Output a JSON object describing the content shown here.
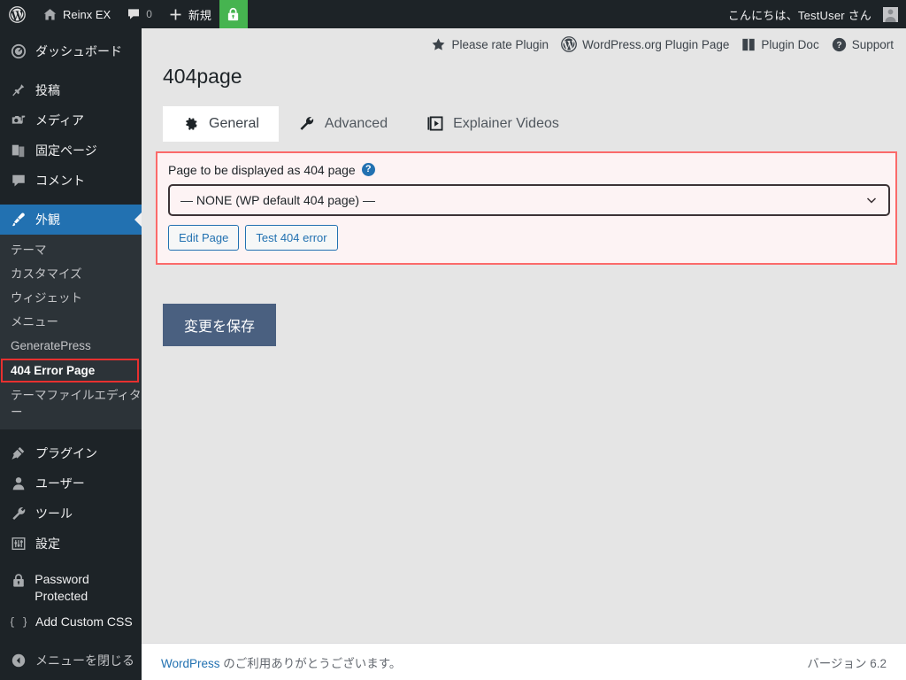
{
  "adminbar": {
    "wp_logo_icon": "wordpress-logo-icon",
    "site_icon": "home-icon",
    "site_name": "Reinx EX",
    "comments_icon": "comment-bubble-icon",
    "comments_count": "0",
    "new_icon": "plus-icon",
    "new_label": "新規",
    "lock_icon": "lock-icon",
    "greeting": "こんにちは、TestUser さん",
    "avatar_icon": "user-avatar-icon"
  },
  "sidebar": {
    "items": [
      {
        "label": "ダッシュボード",
        "icon": "dashboard-gauge-icon",
        "key": "dashboard"
      },
      {
        "label": "投稿",
        "icon": "pin-icon",
        "key": "posts"
      },
      {
        "label": "メディア",
        "icon": "media-camera-music-icon",
        "key": "media"
      },
      {
        "label": "固定ページ",
        "icon": "pages-icon",
        "key": "pages"
      },
      {
        "label": "コメント",
        "icon": "comment-bubble-icon",
        "key": "comments"
      },
      {
        "label": "外観",
        "icon": "paintbrush-icon",
        "key": "appearance",
        "current": true
      },
      {
        "label": "プラグイン",
        "icon": "plug-icon",
        "key": "plugins"
      },
      {
        "label": "ユーザー",
        "icon": "user-icon",
        "key": "users"
      },
      {
        "label": "ツール",
        "icon": "wrench-icon",
        "key": "tools"
      },
      {
        "label": "設定",
        "icon": "sliders-icon",
        "key": "settings"
      },
      {
        "label": "Password Protected",
        "icon": "lock-icon",
        "key": "password-protected"
      },
      {
        "label": "Add Custom CSS",
        "icon": "curly-braces-icon",
        "key": "add-custom-css"
      }
    ],
    "appearance_submenu": [
      {
        "label": "テーマ",
        "key": "themes"
      },
      {
        "label": "カスタマイズ",
        "key": "customize"
      },
      {
        "label": "ウィジェット",
        "key": "widgets"
      },
      {
        "label": "メニュー",
        "key": "menus"
      },
      {
        "label": "GeneratePress",
        "key": "generatepress"
      },
      {
        "label": "404 Error Page",
        "key": "404-error-page",
        "current": true,
        "highlighted": true
      },
      {
        "label": "テーマファイルエディター",
        "key": "theme-file-editor"
      }
    ],
    "collapse_label": "メニューを閉じる",
    "collapse_icon": "collapse-arrow-icon"
  },
  "plugin_links": [
    {
      "label": "Please rate Plugin",
      "icon": "star-icon"
    },
    {
      "label": "WordPress.org Plugin Page",
      "icon": "wordpress-logo-icon"
    },
    {
      "label": "Plugin Doc",
      "icon": "book-icon"
    },
    {
      "label": "Support",
      "icon": "question-circle-icon"
    }
  ],
  "page": {
    "title": "404page"
  },
  "tabs": [
    {
      "label": "General",
      "icon": "gear-icon",
      "active": true
    },
    {
      "label": "Advanced",
      "icon": "wrench-icon",
      "active": false
    },
    {
      "label": "Explainer Videos",
      "icon": "video-icon",
      "active": false
    }
  ],
  "settings": {
    "field_label": "Page to be displayed as 404 page",
    "help_icon": "question-circle-icon",
    "help_glyph": "?",
    "select_value": "— NONE (WP default 404 page) —",
    "select_caret_icon": "chevron-down-icon",
    "edit_page_label": "Edit Page",
    "test_404_label": "Test 404 error",
    "panel_border_color": "#fb6a6a",
    "panel_background": "#fdf3f4"
  },
  "save_button_label": "変更を保存",
  "footer": {
    "thanks_link": "WordPress",
    "thanks_text": " のご利用ありがとうございます。",
    "version": "バージョン 6.2"
  },
  "colors": {
    "admin_dark": "#1d2327",
    "admin_submenu": "#2c3338",
    "accent_blue": "#2271b1",
    "green": "#46b450",
    "highlight_red": "#e8302f",
    "save_blue": "#4a6080"
  }
}
